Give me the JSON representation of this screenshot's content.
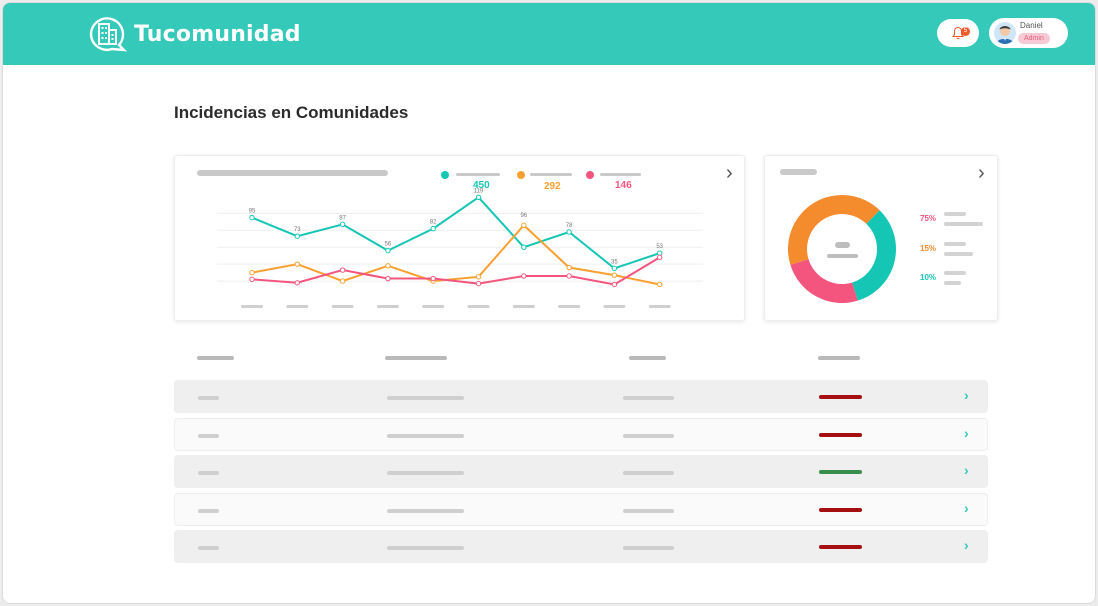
{
  "app": {
    "name": "Tucomunidad"
  },
  "header": {
    "notifications_count": "5",
    "user": {
      "name": "Daniel",
      "role": "Admin"
    }
  },
  "colors": {
    "teal": "#15c6b5",
    "orange": "#f9a030",
    "pink": "#f3557f",
    "red_status": "#a50f12",
    "green_status": "#3a8e4c",
    "topbar": "#34c9b8"
  },
  "page": {
    "title": "Incidencias en Comunidades"
  },
  "line_card": {
    "legend": [
      {
        "value": "450",
        "color": "#15c6b5"
      },
      {
        "value": "292",
        "color": "#f9a030"
      },
      {
        "value": "146",
        "color": "#f3557f"
      }
    ]
  },
  "donut_card": {
    "legend": [
      {
        "label": "75%",
        "color": "#f3557f"
      },
      {
        "label": "15%",
        "color": "#f48b2c"
      },
      {
        "label": "10%",
        "color": "#15c6b5"
      }
    ]
  },
  "chart_data": [
    {
      "type": "line",
      "x": [
        1,
        2,
        3,
        4,
        5,
        6,
        7,
        8,
        9,
        10
      ],
      "ylim": [
        0,
        130
      ],
      "grid": true,
      "series": [
        {
          "color": "#15c6b5",
          "values": [
            95,
            73,
            87,
            56,
            82,
            119,
            60,
            78,
            35,
            53
          ],
          "labels": [
            "95",
            "73",
            "87",
            "56",
            "82",
            "119",
            "96",
            "78",
            "35",
            "53"
          ]
        },
        {
          "color": "#f9a030",
          "values": [
            30,
            40,
            20,
            38,
            20,
            25,
            86,
            36,
            27,
            16
          ]
        },
        {
          "color": "#f3557f",
          "values": [
            22,
            18,
            33,
            23,
            23,
            17,
            26,
            26,
            16,
            48
          ]
        }
      ]
    },
    {
      "type": "pie",
      "donut": true,
      "slices": [
        {
          "label": "75%",
          "value": 25,
          "color": "#f3557f"
        },
        {
          "label": "15%",
          "value": 42,
          "color": "#f48b2c"
        },
        {
          "label": "10%",
          "value": 33,
          "color": "#15c6b5"
        }
      ]
    }
  ],
  "table": {
    "rows": [
      {
        "status": "#a50f12"
      },
      {
        "status": "#a50f12"
      },
      {
        "status": "#3a8e4c"
      },
      {
        "status": "#a50f12"
      },
      {
        "status": "#a50f12"
      }
    ]
  }
}
